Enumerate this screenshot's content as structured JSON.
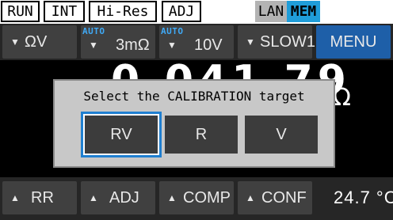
{
  "status_flags": [
    "RUN",
    "INT",
    "Hi-Res",
    "ADJ"
  ],
  "network_flags": [
    "LAN",
    "MEM"
  ],
  "top_softkeys": [
    {
      "arrow": "▼",
      "label": "ΩV",
      "auto": ""
    },
    {
      "arrow": "▼",
      "label": "3mΩ",
      "auto": "AUTO"
    },
    {
      "arrow": "▼",
      "label": "10V",
      "auto": "AUTO"
    },
    {
      "arrow": "▼",
      "label": "SLOW1",
      "auto": ""
    }
  ],
  "menu_label": "MENU",
  "reading": {
    "main": "0.041 79",
    "suffix": "Ω"
  },
  "dialog": {
    "title": "Select the CALIBRATION target",
    "options": [
      "RV",
      "R",
      "V"
    ],
    "selected": "RV"
  },
  "bottom_softkeys": [
    {
      "arrow": "▲",
      "label": "RR"
    },
    {
      "arrow": "▲",
      "label": "ADJ"
    },
    {
      "arrow": "▲",
      "label": "COMP"
    },
    {
      "arrow": "▲",
      "label": "CONF"
    }
  ],
  "temperature": "24.7 °C",
  "colors": {
    "accent": "#1f9dd9",
    "menu": "#1e5fa8",
    "selection": "#1f7fd0"
  }
}
